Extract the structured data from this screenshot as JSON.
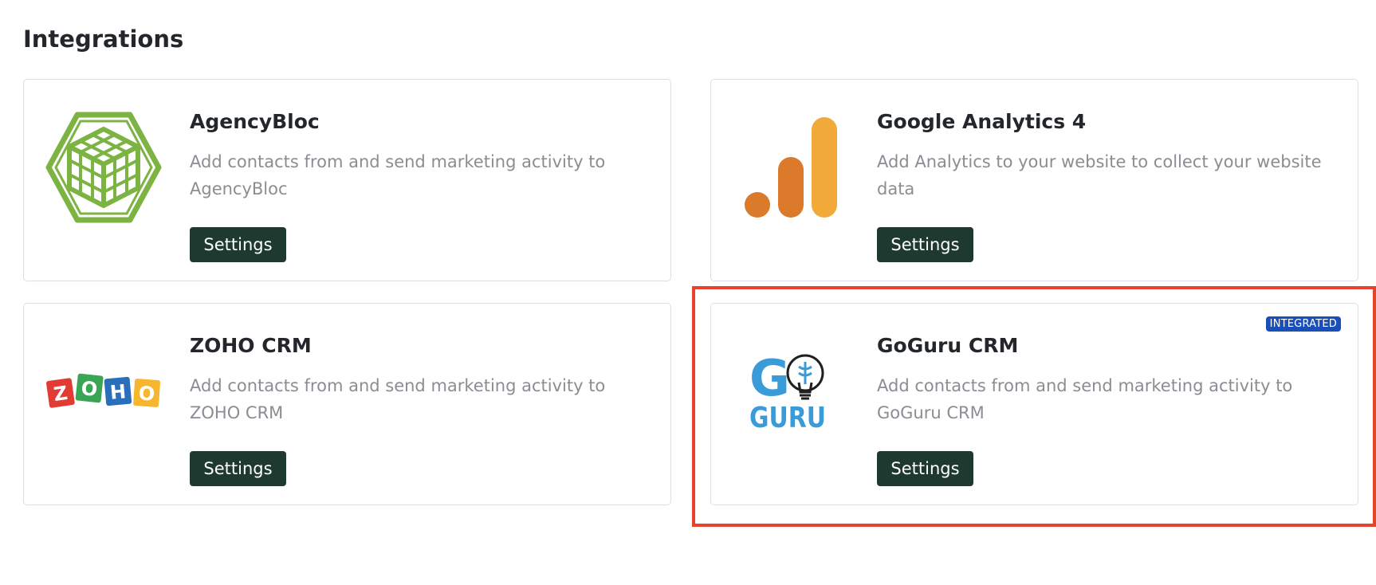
{
  "page": {
    "title": "Integrations"
  },
  "integrations": [
    {
      "name": "AgencyBloc",
      "description": "Add contacts from and send marketing activity to AgencyBloc",
      "button_label": "Settings",
      "icon": "agencybloc-logo-icon",
      "brand_color": "#7cb342"
    },
    {
      "name": "Google Analytics 4",
      "description": "Add Analytics to your website to collect your website data",
      "button_label": "Settings",
      "icon": "google-analytics-logo-icon",
      "brand_color": "#f1a93a"
    },
    {
      "name": "ZOHO CRM",
      "description": "Add contacts from and send marketing activity to ZOHO CRM",
      "button_label": "Settings",
      "icon": "zoho-logo-icon",
      "logo_text": "ZOHO",
      "brand_colors": [
        "#e23b33",
        "#3aa655",
        "#2a6fbc",
        "#f6b72f"
      ]
    },
    {
      "name": "GoGuru CRM",
      "description": "Add contacts from and send marketing activity to GoGuru CRM",
      "button_label": "Settings",
      "icon": "goguru-logo-icon",
      "logo_text": "GO GURU",
      "badge": "INTEGRATED",
      "brand_color": "#3a9bd9"
    }
  ],
  "colors": {
    "button_bg": "#1e3a30",
    "badge_bg": "#1b4fb8",
    "highlight": "#e5432d"
  }
}
